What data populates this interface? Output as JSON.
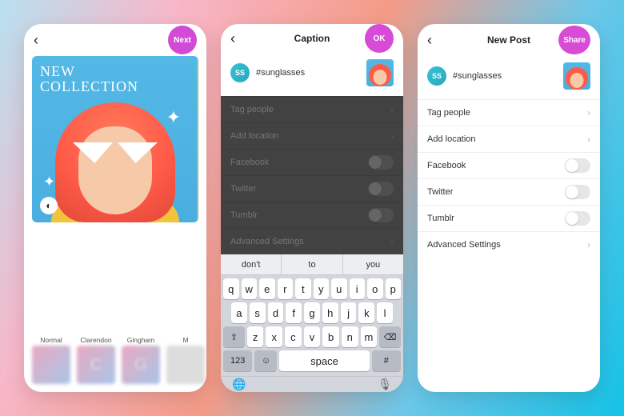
{
  "phone1": {
    "header": {
      "back": "‹",
      "action": "Next"
    },
    "photo": {
      "overlay_line1": "NEW",
      "overlay_line2": "COLLECTION",
      "chip_icon": "◐"
    },
    "filters": [
      {
        "label": "Normal",
        "badge": ""
      },
      {
        "label": "Clarendon",
        "badge": "C"
      },
      {
        "label": "Gingham",
        "badge": "G"
      },
      {
        "label": "M",
        "badge": ""
      }
    ]
  },
  "phone2": {
    "header": {
      "back": "‹",
      "title": "Caption",
      "action": "OK"
    },
    "avatar": "SS",
    "caption": "#sunglasses",
    "rows": [
      {
        "label": "Tag people",
        "type": "nav"
      },
      {
        "label": "Add location",
        "type": "nav"
      },
      {
        "label": "Facebook",
        "type": "toggle"
      },
      {
        "label": "Twitter",
        "type": "toggle"
      },
      {
        "label": "Tumblr",
        "type": "toggle"
      },
      {
        "label": "Advanced Settings",
        "type": "nav"
      }
    ],
    "keyboard": {
      "suggestions": [
        "don't",
        "to",
        "you"
      ],
      "row1": [
        "q",
        "w",
        "e",
        "r",
        "t",
        "y",
        "u",
        "i",
        "o",
        "p"
      ],
      "row2": [
        "a",
        "s",
        "d",
        "f",
        "g",
        "h",
        "j",
        "k",
        "l"
      ],
      "row3_shift": "⇧",
      "row3": [
        "z",
        "x",
        "c",
        "v",
        "b",
        "n",
        "m"
      ],
      "row3_del": "⌫",
      "row4": {
        "numkey": "123",
        "emoji": "☺",
        "space": "space",
        "return": "#"
      },
      "bottom": {
        "globe": "🌐",
        "mic": "🎙"
      }
    }
  },
  "phone3": {
    "header": {
      "back": "‹",
      "title": "New Post",
      "action": "Share"
    },
    "avatar": "SS",
    "caption": "#sunglasses",
    "rows": [
      {
        "label": "Tag people",
        "type": "nav"
      },
      {
        "label": "Add location",
        "type": "nav"
      },
      {
        "label": "Facebook",
        "type": "toggle"
      },
      {
        "label": "Twitter",
        "type": "toggle"
      },
      {
        "label": "Tumblr",
        "type": "toggle"
      },
      {
        "label": "Advanced Settings",
        "type": "nav"
      }
    ]
  }
}
